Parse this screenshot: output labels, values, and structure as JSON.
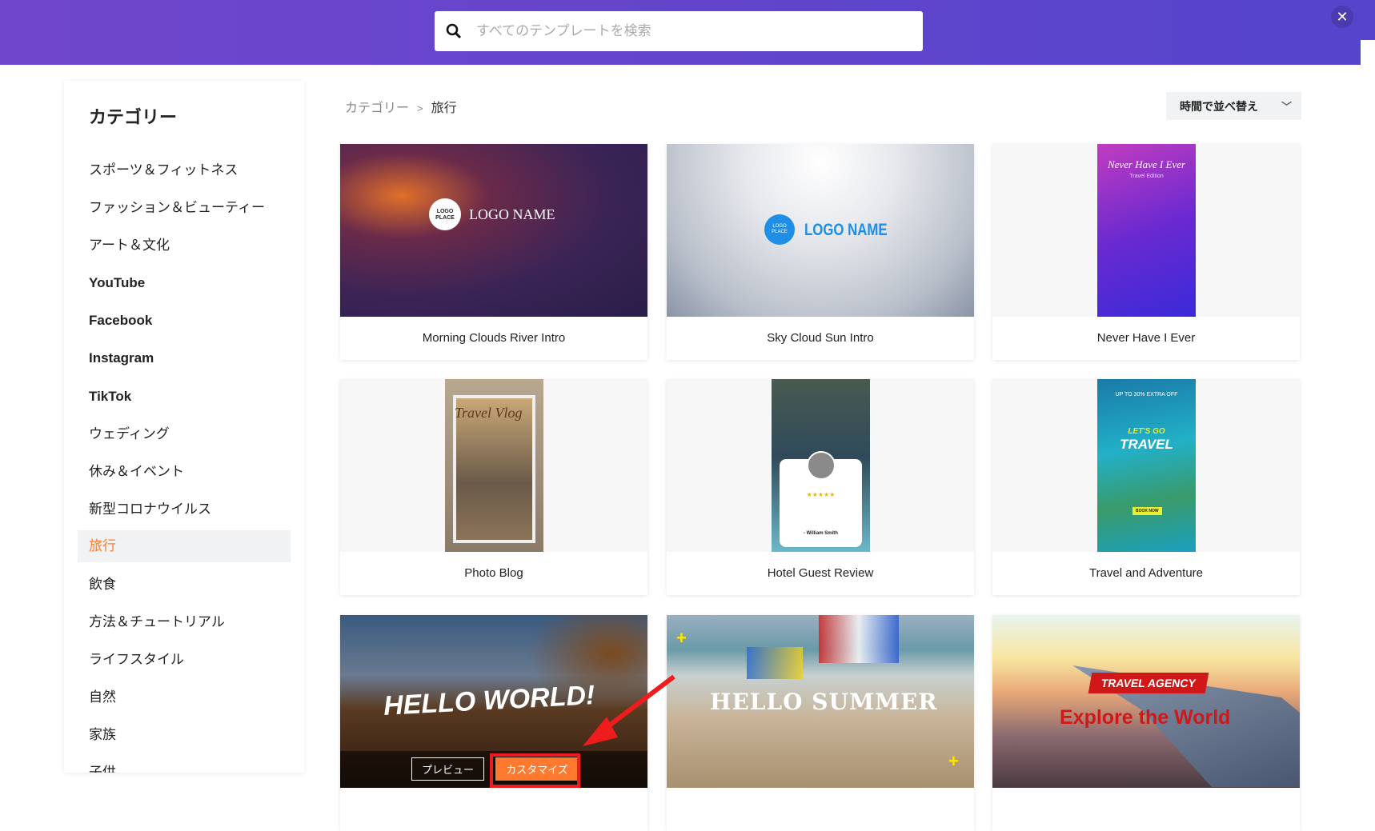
{
  "search": {
    "placeholder": "すべてのテンプレートを検索"
  },
  "sidebar": {
    "title": "カテゴリー",
    "items": [
      {
        "label": "スポーツ＆フィットネス"
      },
      {
        "label": "ファッション＆ビューティー"
      },
      {
        "label": "アート＆文化"
      },
      {
        "label": "YouTube"
      },
      {
        "label": "Facebook"
      },
      {
        "label": "Instagram"
      },
      {
        "label": "TikTok"
      },
      {
        "label": "ウェディング"
      },
      {
        "label": "休み＆イベント"
      },
      {
        "label": "新型コロナウイルス"
      },
      {
        "label": "旅行",
        "active": true
      },
      {
        "label": "飲食"
      },
      {
        "label": "方法＆チュートリアル"
      },
      {
        "label": "ライフスタイル"
      },
      {
        "label": "自然"
      },
      {
        "label": "家族"
      },
      {
        "label": "子供"
      }
    ]
  },
  "breadcrumb": {
    "root": "カテゴリー",
    "sep": ">",
    "current": "旅行"
  },
  "sort": {
    "label": "時間で並べ替え"
  },
  "accent": "#ff7a2f",
  "cards": [
    {
      "title": "Morning Clouds River Intro",
      "logo": "LOGO PLACE",
      "text": "LOGO NAME"
    },
    {
      "title": "Sky Cloud Sun Intro",
      "logo": "LOGO PLACE",
      "text": "LOGO NAME"
    },
    {
      "title": "Never Have I Ever",
      "text": "Never Have I Ever",
      "sub": "Travel Edition"
    },
    {
      "title": "Photo Blog",
      "text": "Travel Vlog"
    },
    {
      "title": "Hotel Guest Review",
      "text": "★★★★★",
      "sub": "- William Smith"
    },
    {
      "title": "Travel and Adventure",
      "top": "UP TO 30% EXTRA OFF",
      "text": "LET'S GO",
      "sub": "TRAVEL",
      "btn": "BOOK NOW"
    },
    {
      "text": "HELLO WORLD!",
      "preview": "プレビュー",
      "customize": "カスタマイズ"
    },
    {
      "text": "HELLO SUMMER"
    },
    {
      "badge": "TRAVEL AGENCY",
      "text": "Explore the World"
    }
  ]
}
